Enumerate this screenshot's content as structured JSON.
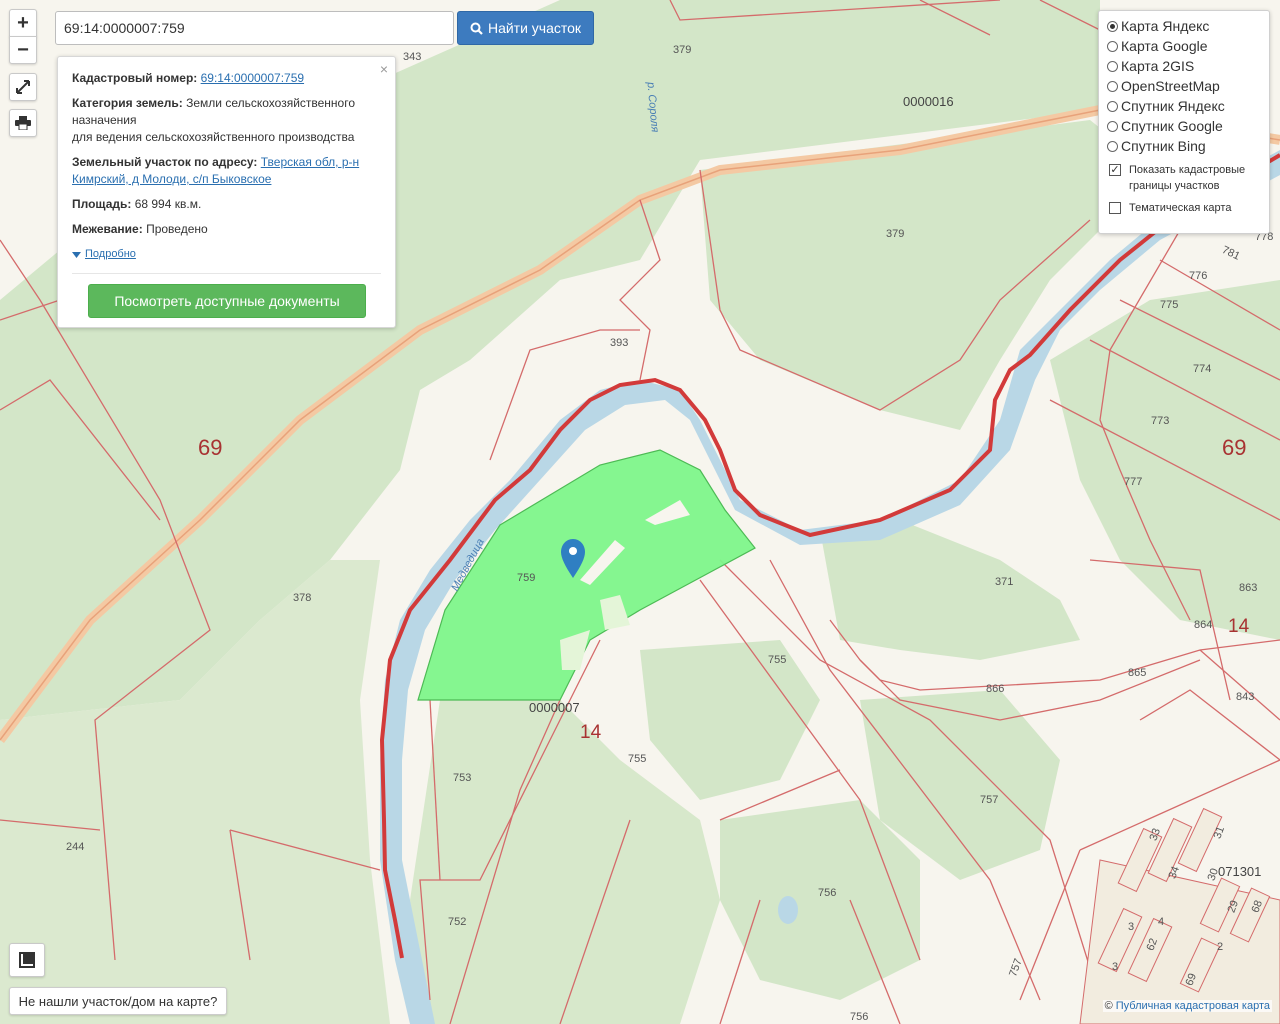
{
  "search": {
    "value": "69:14:0000007:759",
    "button_label": "Найти участок"
  },
  "zoom": {
    "in": "+",
    "out": "−"
  },
  "info": {
    "cad_label": "Кадастровый номер:",
    "cad_value": "69:14:0000007:759",
    "category_label": "Категория земель:",
    "category_value": "Земли сельскохозяйственного назначения",
    "usage_value": "для ведения сельскохозяйственного производства",
    "address_label": "Земельный участок по адресу:",
    "address_value": "Тверская обл, р-н Кимрский, д Молоди, с/п Быковское",
    "area_label": "Площадь:",
    "area_value": "68 994 кв.м.",
    "survey_label": "Межевание:",
    "survey_value": "Проведено",
    "more_link": "Подробно",
    "docs_button": "Посмотреть доступные документы",
    "close": "×"
  },
  "layers": {
    "options": [
      {
        "label": "Карта Яндекс",
        "selected": true
      },
      {
        "label": "Карта Google",
        "selected": false
      },
      {
        "label": "Карта 2GIS",
        "selected": false
      },
      {
        "label": "OpenStreetMap",
        "selected": false
      },
      {
        "label": "Спутник Яндекс",
        "selected": false
      },
      {
        "label": "Спутник Google",
        "selected": false
      },
      {
        "label": "Спутник Bing",
        "selected": false
      }
    ],
    "show_borders": {
      "label": "Показать кадастровые границы участков",
      "checked": true
    },
    "thematic": {
      "label": "Тематическая карта",
      "checked": false
    }
  },
  "not_found": "Не нашли участок/дом на карте?",
  "attribution": {
    "copyright": "©",
    "link": "Публичная кадастровая карта"
  },
  "map_labels": {
    "river1": "р. Сороля",
    "river2": "Медведица",
    "region_69": "69",
    "district_14": "14",
    "quarter_7": "0000007",
    "quarter_16": "0000016",
    "quarter_1301": "071301",
    "parcels": [
      "343",
      "379",
      "379",
      "393",
      "759",
      "378",
      "244",
      "753",
      "755",
      "755",
      "757",
      "756",
      "756",
      "752",
      "757",
      "371",
      "866",
      "865",
      "863",
      "864",
      "843",
      "778",
      "776",
      "775",
      "774",
      "773",
      "777",
      "781",
      "33",
      "34",
      "30",
      "31",
      "29",
      "68",
      "62",
      "4",
      "3",
      "3",
      "69",
      "2"
    ]
  },
  "colors": {
    "parcel_fill": "#7ef58a",
    "border_red": "#d23a3a",
    "river": "#b9d7e6",
    "forest": "#d3e6c8",
    "marker": "#2f7fc2"
  }
}
